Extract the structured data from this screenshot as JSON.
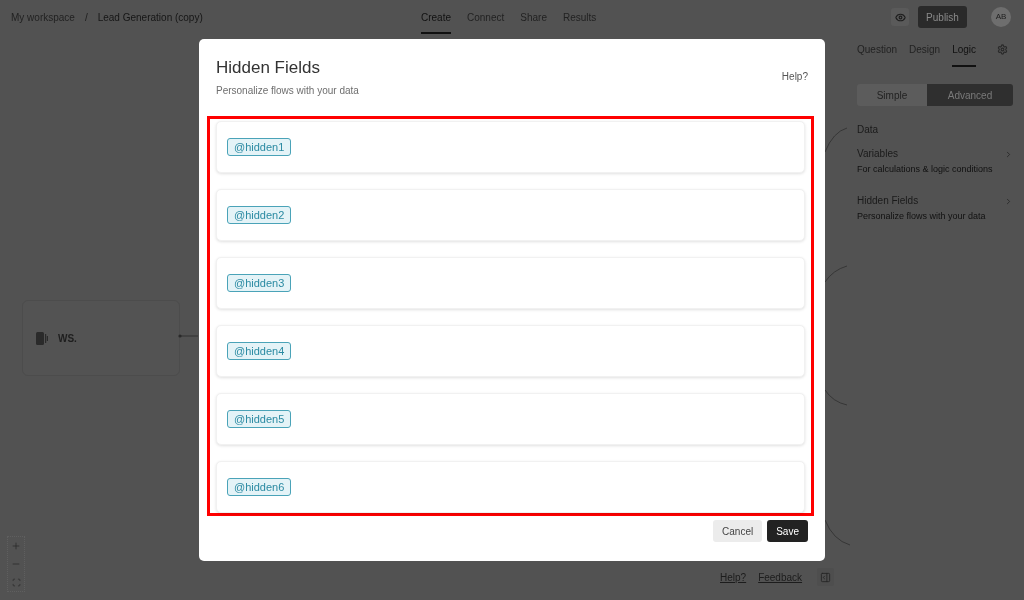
{
  "header": {
    "breadcrumb": [
      "My workspace",
      "Lead Generation (copy)"
    ],
    "separator": "/",
    "tabs": [
      {
        "label": "Create",
        "selected": true
      },
      {
        "label": "Connect",
        "selected": false
      },
      {
        "label": "Share",
        "selected": false
      },
      {
        "label": "Results",
        "selected": false
      }
    ],
    "publish_button": "Publish",
    "avatar": "AB"
  },
  "canvas": {
    "node": {
      "label": "WS."
    },
    "footer_links": [
      "Help?",
      "Feedback"
    ]
  },
  "side_panel": {
    "tabs": [
      {
        "label": "Question",
        "selected": false
      },
      {
        "label": "Design",
        "selected": false
      },
      {
        "label": "Logic",
        "selected": true
      }
    ],
    "modes": [
      {
        "label": "Simple",
        "selected": false
      },
      {
        "label": "Advanced",
        "selected": true
      }
    ],
    "section": "Data",
    "items": [
      {
        "title": "Variables",
        "description": "For calculations & logic conditions"
      },
      {
        "title": "Hidden Fields",
        "description": "Personalize flows with your data"
      }
    ]
  },
  "dialog": {
    "title": "Hidden Fields",
    "subtitle": "Personalize flows with your data",
    "help": "Help?",
    "highlighted": true,
    "fields": [
      {
        "tag": "@hidden1"
      },
      {
        "tag": "@hidden2"
      },
      {
        "tag": "@hidden3"
      },
      {
        "tag": "@hidden4"
      },
      {
        "tag": "@hidden5"
      },
      {
        "tag": "@hidden6"
      }
    ],
    "buttons": [
      {
        "label": "Cancel",
        "kind": "secondary"
      },
      {
        "label": "Save",
        "kind": "primary"
      }
    ]
  }
}
